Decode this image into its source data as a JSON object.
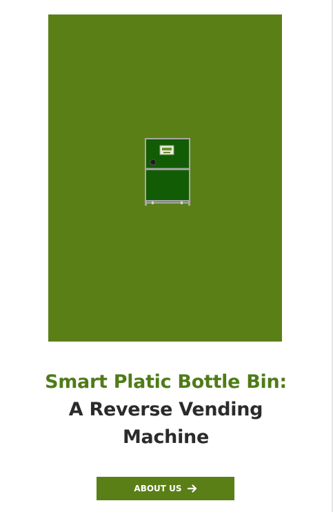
{
  "hero": {
    "image": "reverse-vending-machine-illustration"
  },
  "heading": {
    "accent": "Smart Platic Bottle Bin:",
    "line2": "A Reverse Vending",
    "line3": "Machine"
  },
  "cta": {
    "label": "ABOUT US",
    "icon": "arrow-right-icon"
  },
  "colors": {
    "brand_green": "#5b7f17",
    "heading_dark": "#2b2b2b",
    "machine_green": "#125c06"
  }
}
